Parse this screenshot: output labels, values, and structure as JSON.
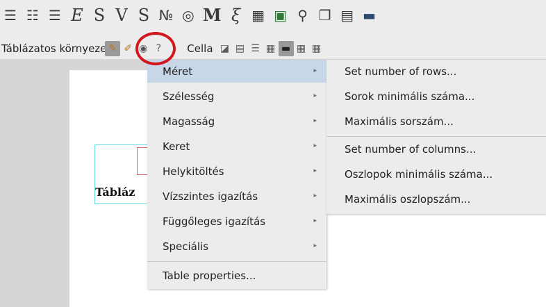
{
  "toolbar_top": {
    "icons": [
      "align-left-icon",
      "align-center-icon",
      "align-right-icon",
      "italic-e-icon",
      "s-icon",
      "v-icon",
      "s-underline-icon",
      "numero-icon",
      "shape-icon",
      "math-m-icon",
      "xi-subscript-icon",
      "table-grid-icon",
      "image-icon",
      "link-icon",
      "copy-icon",
      "film-icon",
      "monitor-icon"
    ],
    "glyphs": [
      "☰",
      "☷",
      "☰",
      "E",
      "S",
      "V",
      "S",
      "№",
      "◎",
      "M",
      "ξ",
      "▦",
      "▣",
      "⚲",
      "❐",
      "▤",
      "▬"
    ]
  },
  "toolbar_table": {
    "label": "Táblázatos környezet",
    "cell_label": "Cella",
    "help_glyph": "?",
    "eye_glyph": "◉",
    "settings_glyph": "✎",
    "pen_glyph": "✐",
    "cell_icons": [
      "◪",
      "▤",
      "☰",
      "▦",
      "▬",
      "▦",
      "▦"
    ]
  },
  "document": {
    "caption": "Tábláz"
  },
  "menu": {
    "items": [
      {
        "label": "Méret",
        "has_sub": true
      },
      {
        "label": "Szélesség",
        "has_sub": true
      },
      {
        "label": "Magasság",
        "has_sub": true
      },
      {
        "label": "Keret",
        "has_sub": true
      },
      {
        "label": "Helykitöltés",
        "has_sub": true
      },
      {
        "label": "Vízszintes igazítás",
        "has_sub": true
      },
      {
        "label": "Függőleges igazítás",
        "has_sub": true
      },
      {
        "label": "Speciális",
        "has_sub": true
      },
      {
        "label": "Table properties...",
        "has_sub": false
      }
    ],
    "arrow_glyph": "▸"
  },
  "submenu": {
    "items": [
      "Set number of rows...",
      "Sorok minimális száma...",
      "Maximális sorszám...",
      "Set number of columns...",
      "Oszlopok minimális száma...",
      "Maximális oszlopszám..."
    ]
  },
  "colors": {
    "highlight": "#c7d7e8",
    "annotation_ring": "#d0181e",
    "table_border": "#65d9e4",
    "cell_border": "#e06565"
  }
}
